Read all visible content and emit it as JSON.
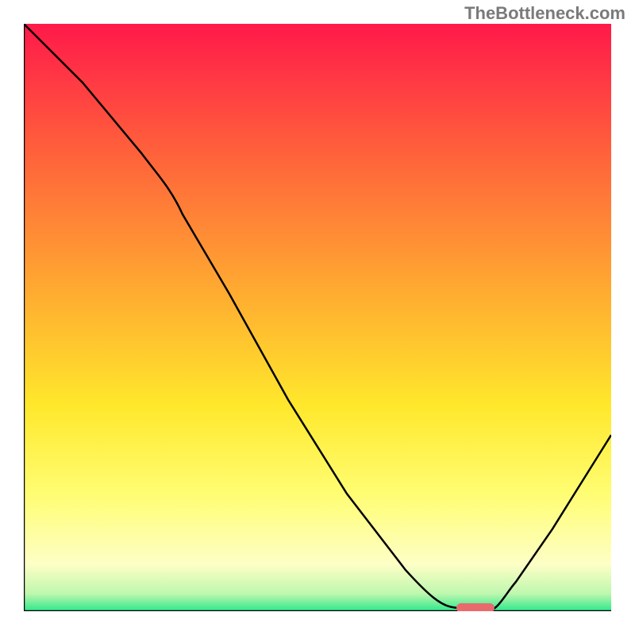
{
  "watermark": "TheBottleneck.com",
  "chart_data": {
    "type": "line",
    "title": "",
    "xlabel": "",
    "ylabel": "",
    "xlim": [
      0,
      100
    ],
    "ylim": [
      0,
      100
    ],
    "grid": false,
    "legend": false,
    "background_gradient": {
      "stops": [
        {
          "offset": 0.0,
          "color": "#ff194a"
        },
        {
          "offset": 0.2,
          "color": "#ff5b3c"
        },
        {
          "offset": 0.45,
          "color": "#ffa931"
        },
        {
          "offset": 0.65,
          "color": "#ffe82c"
        },
        {
          "offset": 0.8,
          "color": "#fffd72"
        },
        {
          "offset": 0.92,
          "color": "#fdffc6"
        },
        {
          "offset": 0.97,
          "color": "#bff7ae"
        },
        {
          "offset": 1.0,
          "color": "#2ce88b"
        }
      ]
    },
    "series": [
      {
        "name": "bottleneck-curve",
        "x": [
          0,
          10,
          20,
          25,
          35,
          45,
          55,
          65,
          72,
          78,
          82,
          90,
          100
        ],
        "y": [
          100,
          90,
          78,
          72,
          54,
          36,
          20,
          7,
          1,
          0,
          3,
          14,
          30
        ]
      }
    ],
    "marker": {
      "name": "optimal-point",
      "x": 77,
      "y": 0,
      "width": 6,
      "color": "#e96a6d"
    }
  }
}
